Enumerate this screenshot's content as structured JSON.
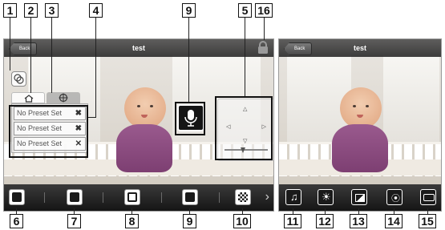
{
  "left_screen": {
    "back_label": "Back",
    "title": "test",
    "preset_rows": [
      {
        "label": "No Preset Set",
        "delete": "✖"
      },
      {
        "label": "No Preset Set",
        "delete": "✖"
      },
      {
        "label": "No Preset Set",
        "delete": "✕"
      }
    ],
    "toolbar_icons": [
      "brightness-icon",
      "camera-settings-icon",
      "snapshot-icon",
      "talk-icon",
      "pattern-icon"
    ]
  },
  "right_screen": {
    "back_label": "Back",
    "title": "test",
    "toolbar_icons": [
      "music-icon",
      "brightness-icon",
      "contrast-icon",
      "focus-icon",
      "recording-icon"
    ]
  },
  "callouts": {
    "c1": "1",
    "c2": "2",
    "c3": "3",
    "c4": "4",
    "c5": "5",
    "c9top": "9",
    "c16": "16",
    "c6": "6",
    "c7": "7",
    "c8": "8",
    "c9bot": "9",
    "c10": "10",
    "c11": "11",
    "c12": "12",
    "c13": "13",
    "c14": "14",
    "c15": "15"
  },
  "colors": {
    "bar_dark": "#1e1e1e",
    "callout_border": "#111111"
  }
}
